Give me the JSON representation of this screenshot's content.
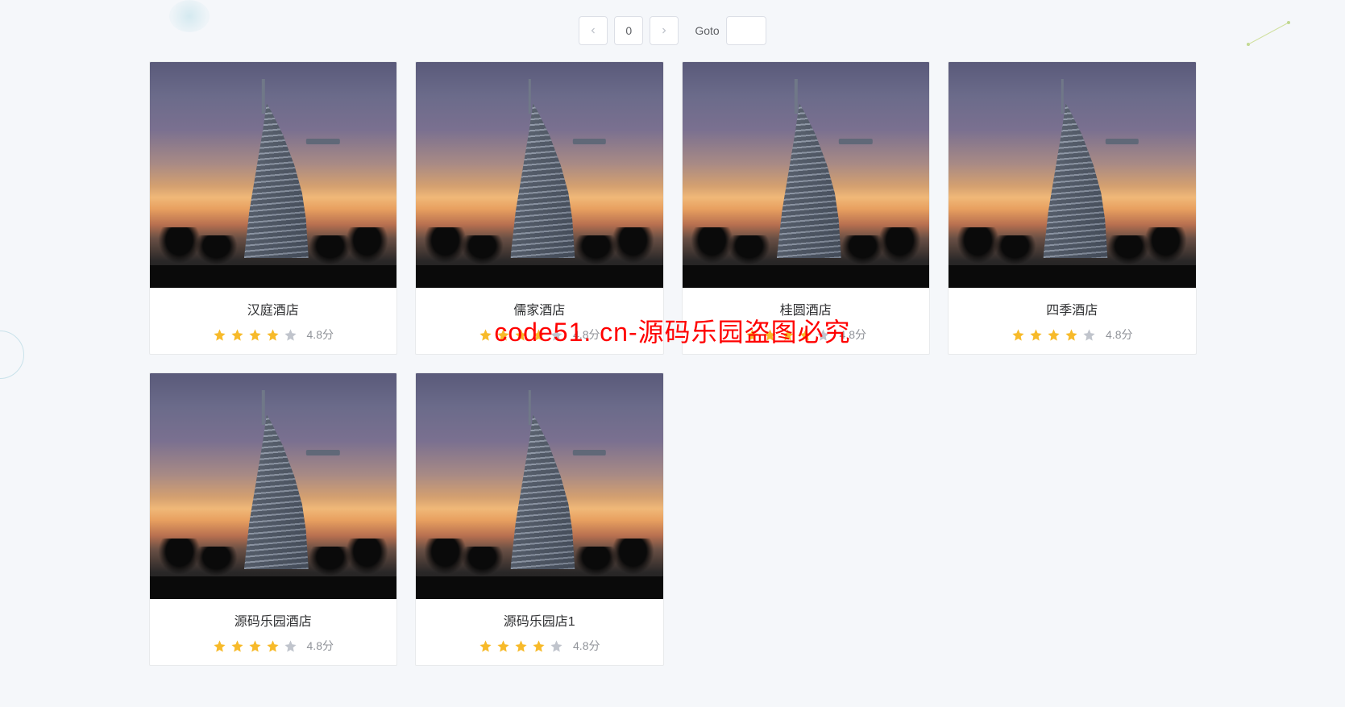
{
  "pagination": {
    "current_page": "0",
    "goto_label": "Goto"
  },
  "hotels": [
    {
      "name": "汉庭酒店",
      "rating": 4,
      "score": "4.8分"
    },
    {
      "name": "儒家酒店",
      "rating": 4,
      "score": "4.8分"
    },
    {
      "name": "桂圆酒店",
      "rating": 4,
      "score": "4.8分"
    },
    {
      "name": "四季酒店",
      "rating": 4,
      "score": "4.8分"
    },
    {
      "name": "源码乐园酒店",
      "rating": 4,
      "score": "4.8分"
    },
    {
      "name": "源码乐园店1",
      "rating": 4,
      "score": "4.8分"
    }
  ],
  "watermark": "code51. cn-源码乐园盗图必究"
}
